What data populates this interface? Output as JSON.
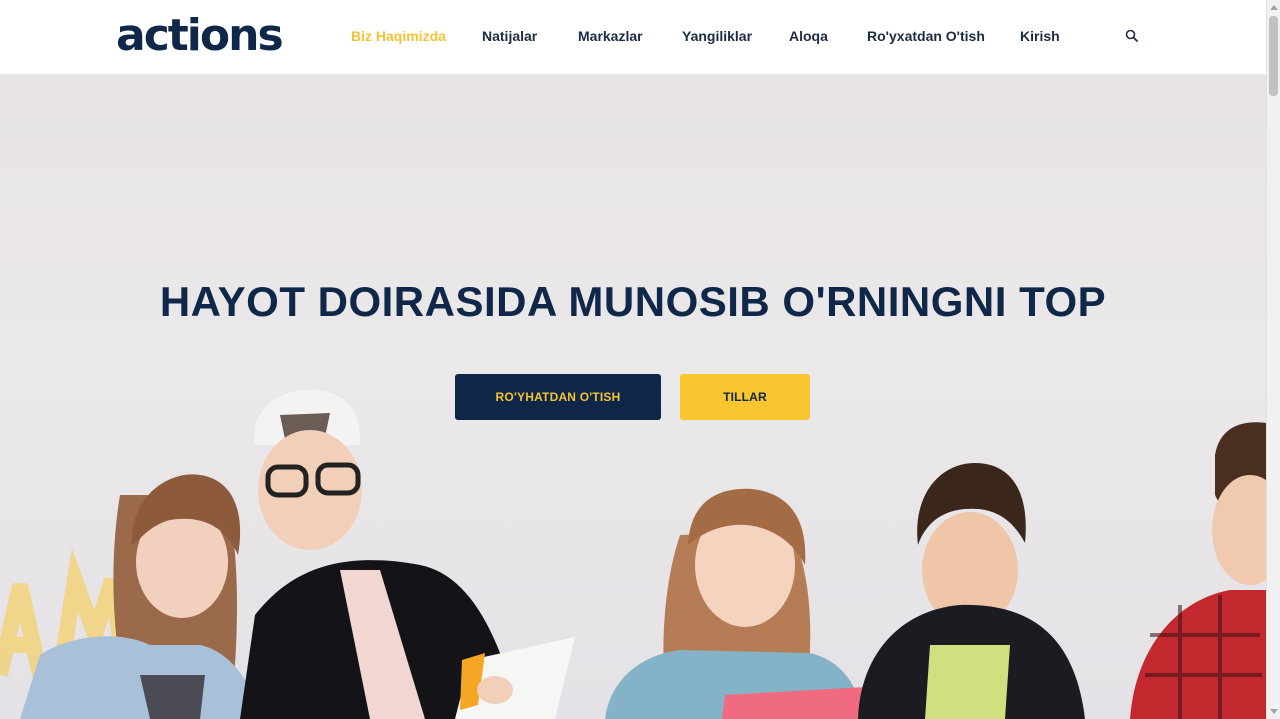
{
  "brand": {
    "logo_text": "actions"
  },
  "nav": {
    "items": [
      {
        "label": "Biz Haqimizda",
        "active": true
      },
      {
        "label": "Natijalar",
        "active": false
      },
      {
        "label": "Markazlar",
        "active": false
      },
      {
        "label": "Yangiliklar",
        "active": false
      },
      {
        "label": "Aloqa",
        "active": false
      },
      {
        "label": "Ro'yxatdan O'tish",
        "active": false
      },
      {
        "label": "Kirish",
        "active": false
      }
    ],
    "search_icon": "search-icon"
  },
  "hero": {
    "title": "HAYOT DOIRASIDA MUNOSIB O'RNINGNI TOP",
    "primary_button": "RO'YHATDAN O'TISH",
    "secondary_button": "TILLAR",
    "image": "group of students reading notebooks"
  },
  "colors": {
    "brand_navy": "#0f2748",
    "accent_yellow": "#f6c234",
    "button_navy": "#0e2647",
    "button_yellow": "#f9c62f"
  }
}
